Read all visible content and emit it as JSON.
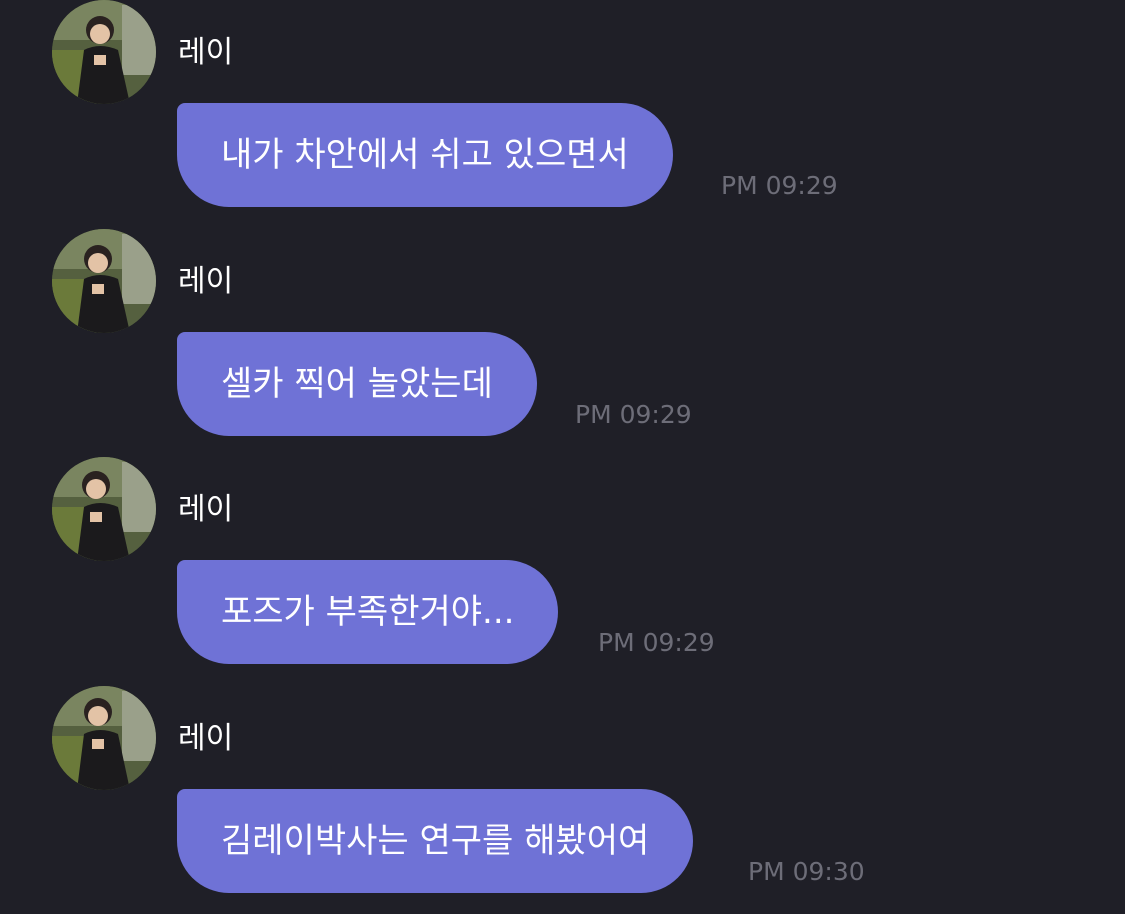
{
  "colors": {
    "background": "#1f1f27",
    "bubble": "#6f72d6",
    "timestamp": "#6d6d78",
    "sender": "#ffffff"
  },
  "messages": [
    {
      "sender": "레이",
      "text": "내가 차안에서 쉬고 있으면서",
      "time": "PM 09:29"
    },
    {
      "sender": "레이",
      "text": "셀카 찍어 놀았는데",
      "time": "PM 09:29"
    },
    {
      "sender": "레이",
      "text": "포즈가 부족한거야...",
      "time": "PM 09:29"
    },
    {
      "sender": "레이",
      "text": "김레이박사는 연구를 해봤어여",
      "time": "PM 09:30"
    }
  ]
}
